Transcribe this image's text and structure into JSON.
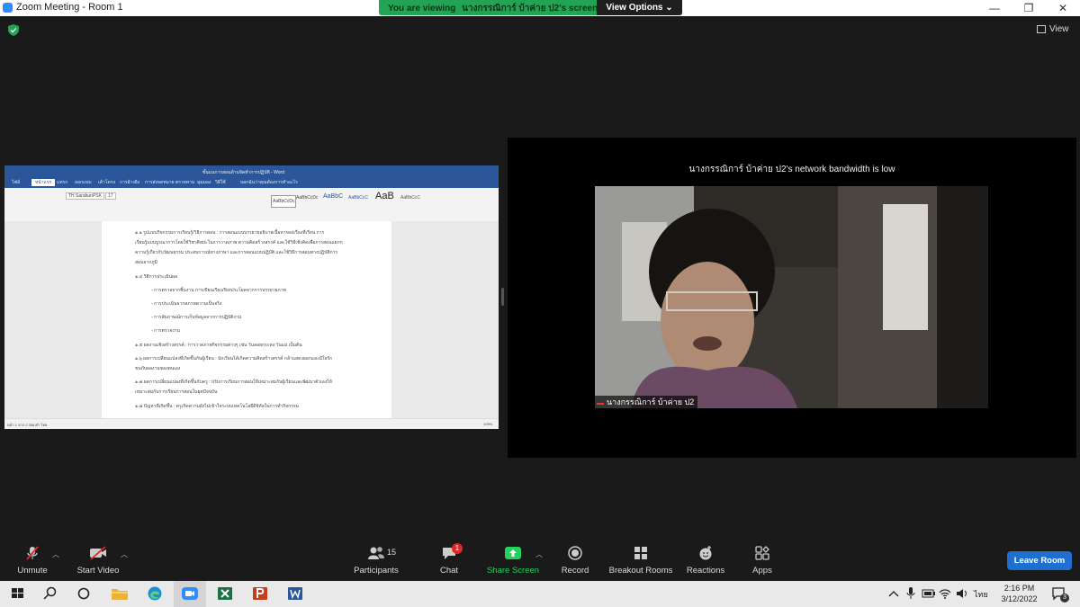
{
  "window": {
    "title": "Zoom Meeting - Room 1",
    "minimize": "—",
    "maximize": "❐",
    "close": "✕"
  },
  "banner": {
    "prefix": "You are viewing",
    "name": "นางกรรณิการ์   บ้าค่าย ป2's screen",
    "view_options": "View Options ⌄"
  },
  "top": {
    "view_label": "View"
  },
  "share": {
    "app_title": "ขั้นแนการสอนด้านจิตทำการปฏิบัติ - Word",
    "tabs": [
      "ไฟล์",
      "หน้าแรก",
      "แทรก",
      "ออกแบบ",
      "เค้าโครง",
      "การอ้างอิง",
      "การส่งจดหมาย",
      "ตรวจทาน",
      "มุมมอง",
      "วิธีใช้",
      "บอกฉันว่าคุณต้องการทำอะไร"
    ],
    "styles": [
      "AaBbCcDc",
      "AaBbCcDc",
      "AaBbC",
      "AaBbCcC",
      "AaB",
      "AaBbCcC"
    ],
    "font_name": "TH SarabunPSK",
    "font_size": "17",
    "lines": [
      "๑.๑ รูปแบบกิจกรรมการเรียนรู้/วิธีการสอน : การสอนแบบบรรยายอธิบายเนื้อหาของเรื่องที่เรียน การ",
      "เรียนรู้แบบบูรณาการโดยใช้วิชาศิลปะในการวาดภาพ ความคิดสร้างสรรค์ และใช้วิธีเชิงคิดเพื่อการสอนแยกก",
      "ความรู้เกี่ยวกับวัฒนธรรม ประสบการณ์ทางภาษา และการสอนแบบปฏิบัติ และใช้วิธีการสอนทางปฏิบัติการ",
      "สอนจากภูมิ",
      "๑.๔ วิธีการประเมินผล",
      "- การตรวจจากชิ้นงาน การเขียนเรียงเรียงประโยคจากการบรรยายภาพ",
      "- การประเมินจากสภาพความเป็นจริง",
      "- การสัมภาษณ์การเก็บข้อมูลจากการปฏิบัติงาน",
      "- การตรวจงาน",
      "๑.๕ ผลงานเชิงสร้างสรรค์ : การวาดภาพกิจกรรมต่างๆ เช่น วันลอยกระทง วันแม่ เป็นต้น",
      "๑.๖ ผลการเปลี่ยนแปลงที่เกิดขึ้นกับผู้เรียน : นักเรียนได้เกิดความคิดสร้างสรรค์ กล้าแสดงออกและมีใจรัก",
      "ขนกับผลงานของตนเอง",
      "๑.๗ ผลการเปลี่ยนแปลงที่เกิดขึ้นกับครู : ปรับการเรียนการสอนให้เหมาะสมกับผู้เรียนและพัฒนาตัวเองให้",
      "เหมาะสมกับการเรียนการสอนในยุคปัจจุบัน",
      "๑.๘ ปัญหาที่เกิดขึ้น : ครูเกิดความยังไม่เข้าใจระบบเทคโนโลยีดิจิทัลในการทำกิจกรรม"
    ],
    "status_left": "หน้า 1 จาก 2    358 คำ    ไทย",
    "status_right": "105%"
  },
  "tile": {
    "bandwidth_notice": "นางกรรณิการ์   บ้าค่าย ป2's network bandwidth is low",
    "participant_name": "นางกรรณิการ์   บ้าค่าย ป2"
  },
  "toolbar": {
    "unmute": "Unmute",
    "start_video": "Start Video",
    "participants": "Participants",
    "participants_count": "15",
    "chat": "Chat",
    "chat_badge": "1",
    "share_screen": "Share Screen",
    "record": "Record",
    "breakout_rooms": "Breakout Rooms",
    "reactions": "Reactions",
    "apps": "Apps",
    "leave_room": "Leave Room"
  },
  "taskbar": {
    "language": "ไทย",
    "time": "2:16 PM",
    "date": "3/12/2022",
    "notification_count": "3"
  },
  "colors": {
    "banner_green": "#23a455",
    "share_green": "#23d25d",
    "leave_blue": "#1f6fd0",
    "word_blue": "#2b579a",
    "chat_badge_red": "#e02828"
  }
}
